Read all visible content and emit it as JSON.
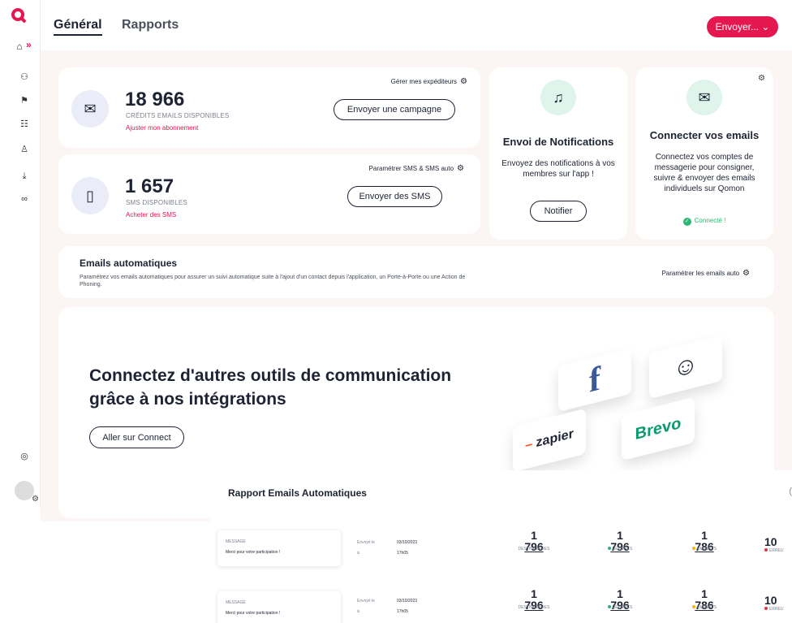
{
  "sidebar": {
    "icons": [
      "home-icon",
      "chevron-double-right-icon",
      "binoculars-icon",
      "flag-icon",
      "chat-icon",
      "user-icon",
      "download-icon",
      "link-icon",
      "help-icon",
      "avatar"
    ]
  },
  "header": {
    "tabs": [
      {
        "label": "Général"
      },
      {
        "label": "Rapports"
      }
    ],
    "send_button": "Envoyer... ⌄"
  },
  "email_card": {
    "count": "18 966",
    "label": "CRÉDITS EMAILS DISPONIBLES",
    "link": "Ajuster mon abonnement",
    "manage": "Gérer mes expéditeurs",
    "button": "Envoyer une campagne"
  },
  "sms_card": {
    "count": "1 657",
    "label": "SMS DISPONIBLES",
    "link": "Acheter des SMS",
    "manage": "Paramétrer SMS & SMS auto",
    "button": "Envoyer des SMS"
  },
  "notif_card": {
    "title": "Envoi de Notifications",
    "desc": "Envoyez des notifications à vos membres sur l'app !",
    "button": "Notifier"
  },
  "connect_card": {
    "title": "Connecter vos emails",
    "desc": "Connectez vos comptes de messagerie pour consigner, suivre & envoyer des emails individuels sur Qomon",
    "status": "Connecté !"
  },
  "auto_card": {
    "title": "Emails automatiques",
    "desc": "Paramétrez vos emails automatiques pour assurer un suivi automatique suite à l'ajout d'un contact depuis l'application, un Porte-à-Porte ou une Action de Phoning.",
    "link": "Paramétrer les emails auto"
  },
  "integrations_card": {
    "title": "Connectez d'autres outils de communication grâce à nos intégrations",
    "button": "Aller sur Connect",
    "logos": [
      "f",
      "zapier",
      "Brevo"
    ]
  },
  "report": {
    "title": "Rapport Emails Automatiques",
    "rows": [
      {
        "msg_label": "MESSAGE",
        "msg_text": "Merci pour votre participation !",
        "sent_label": "Envoyé le",
        "sent_a": "à",
        "date": "03/10/2023",
        "time": "17h05",
        "destinataires": [
          "1",
          "796"
        ],
        "destinataires_label": "DESTINATAIRES",
        "delivres": [
          "1",
          "796"
        ],
        "delivres_label": "DÉLIVRÉS",
        "ouverts": [
          "1",
          "786"
        ],
        "ouverts_label": "OUVERTS",
        "erreurs": "10",
        "erreurs_label": "ERREU"
      },
      {
        "msg_label": "MESSAGE",
        "msg_text": "Merci pour votre participation !",
        "sent_label": "Envoyé le",
        "sent_a": "à",
        "date": "03/10/2023",
        "time": "17h05",
        "destinataires": [
          "1",
          "796"
        ],
        "destinataires_label": "DESTINATAIRES",
        "delivres": [
          "1",
          "796"
        ],
        "delivres_label": "DÉLIVRÉS",
        "ouverts": [
          "1",
          "786"
        ],
        "ouverts_label": "OUVERTS",
        "erreurs": "10",
        "erreurs_label": "ERREU"
      }
    ]
  },
  "colors": {
    "accent": "#e5174f",
    "success": "#2bb673",
    "warning": "#f5b400",
    "error": "#e5343c",
    "background": "#fbf6f3"
  }
}
